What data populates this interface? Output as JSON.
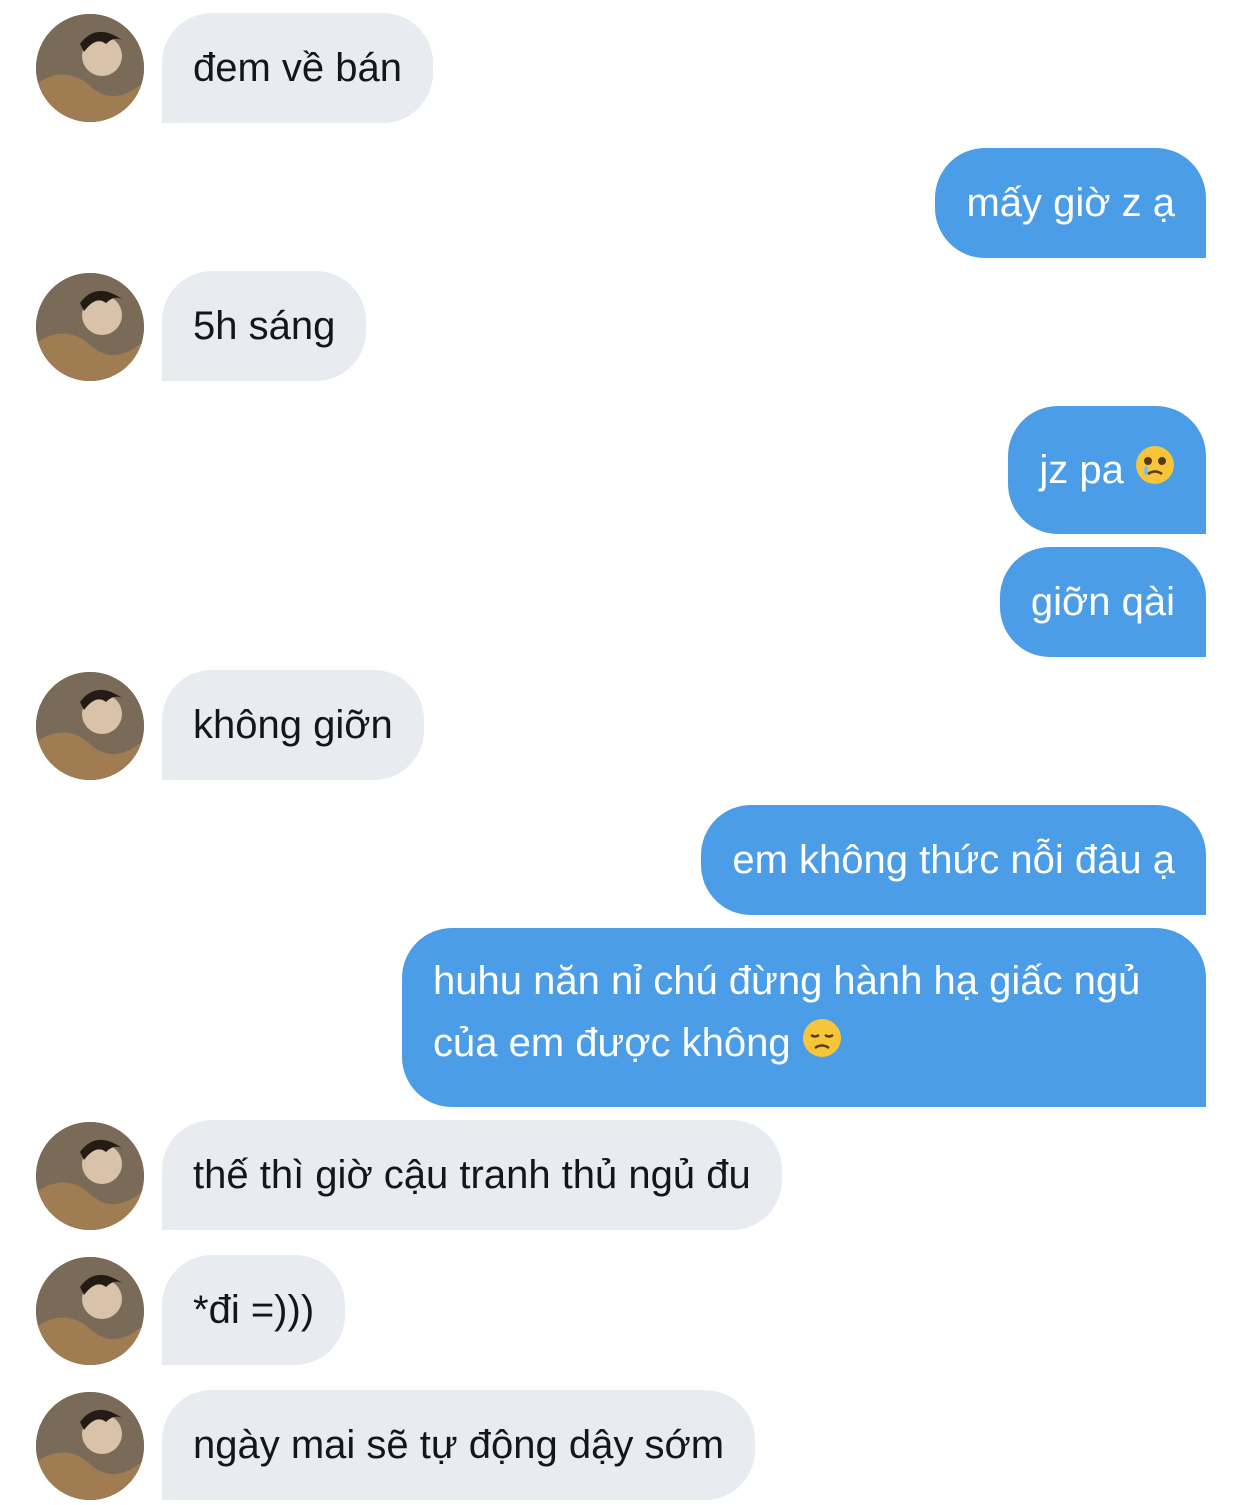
{
  "conversation": {
    "messages": [
      {
        "side": "in",
        "text": "đem về bán"
      },
      {
        "side": "out",
        "text": "mấy giờ z ạ"
      },
      {
        "side": "in",
        "text": "5h sáng"
      },
      {
        "side": "out",
        "text": "jz pa",
        "emoji": "face-holding-back-tears-icon"
      },
      {
        "side": "out",
        "text": "giỡn qài"
      },
      {
        "side": "in",
        "text": "không giỡn"
      },
      {
        "side": "out",
        "text": "em không thức nỗi đâu ạ"
      },
      {
        "side": "out",
        "text": "huhu năn nỉ chú đừng hành hạ giấc ngủ của em được không",
        "emoji": "disappointed-face-icon"
      },
      {
        "side": "in",
        "text": "thế thì giờ cậu tranh thủ ngủ đu"
      },
      {
        "side": "in",
        "text": "*đi =)))"
      },
      {
        "side": "in",
        "text": "ngày mai sẽ tự động dậy sớm"
      }
    ]
  },
  "colors": {
    "incoming_bubble": "#e8ebf0",
    "outgoing_bubble": "#4b9de8",
    "incoming_text": "#14171a",
    "outgoing_text": "#ffffff"
  }
}
